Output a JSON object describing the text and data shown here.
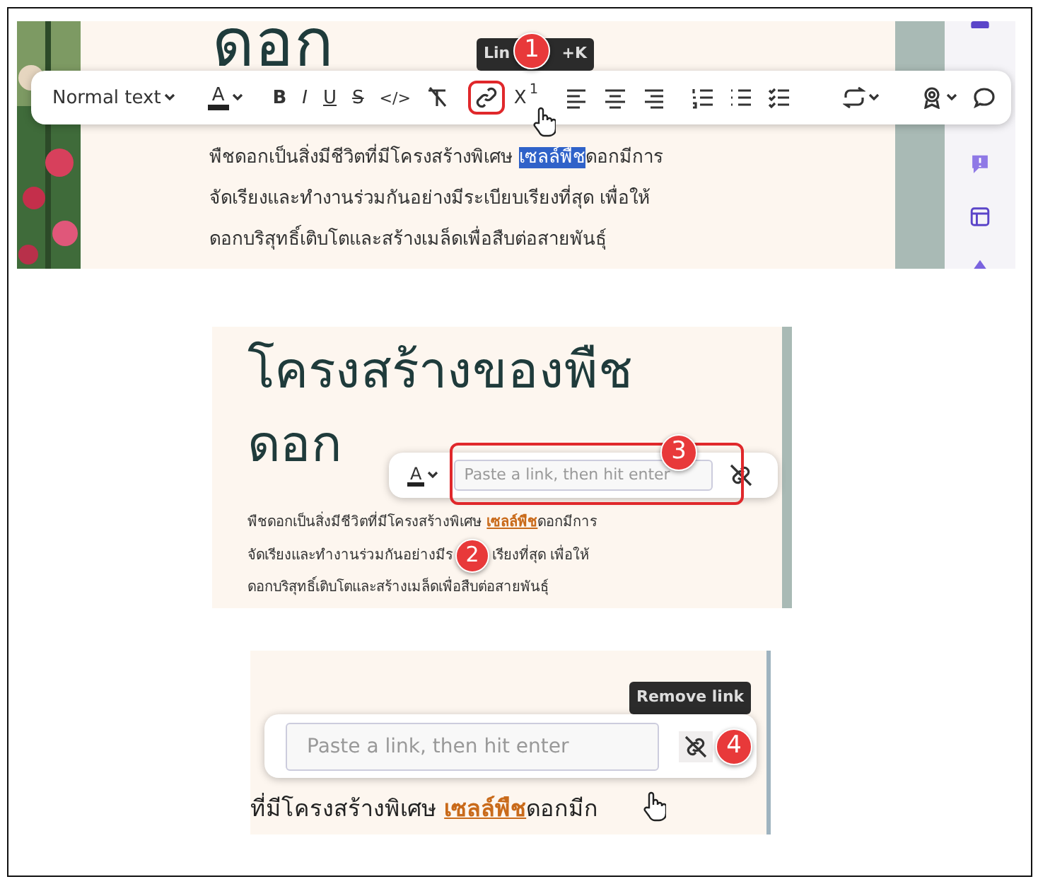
{
  "editor_view": {
    "title": "ดอก",
    "tooltip_parts": [
      "Lin",
      "+K"
    ],
    "callout": "1",
    "toolbar": [
      {
        "kind": "style-menu",
        "label": "Normal text",
        "dropdown": true,
        "highlighted": false
      },
      {
        "kind": "text-color",
        "label": "A",
        "dropdown": true,
        "highlighted": false
      },
      {
        "kind": "bold",
        "label": "B",
        "dropdown": false,
        "highlighted": false
      },
      {
        "kind": "italic",
        "label": "I",
        "dropdown": false,
        "highlighted": false
      },
      {
        "kind": "underline",
        "label": "U",
        "dropdown": false,
        "highlighted": false
      },
      {
        "kind": "strike",
        "label": "S",
        "dropdown": false,
        "highlighted": false
      },
      {
        "kind": "code",
        "label": "</>",
        "dropdown": false,
        "highlighted": false
      },
      {
        "kind": "clear-format",
        "dropdown": false,
        "highlighted": false
      },
      {
        "kind": "link",
        "dropdown": false,
        "highlighted": true
      },
      {
        "kind": "superscript",
        "label": "X$^{1}$",
        "dropdown": false,
        "highlighted": false
      },
      {
        "kind": "align-left",
        "dropdown": false,
        "highlighted": false
      },
      {
        "kind": "align-center",
        "dropdown": false,
        "highlighted": false
      },
      {
        "kind": "align-right",
        "dropdown": false,
        "highlighted": false
      },
      {
        "kind": "numbered-list",
        "dropdown": false,
        "highlighted": false
      },
      {
        "kind": "bullet-list",
        "dropdown": false,
        "highlighted": false
      },
      {
        "kind": "task-list",
        "dropdown": false,
        "highlighted": false
      },
      {
        "kind": "loop",
        "dropdown": true,
        "highlighted": false
      },
      {
        "kind": "ai",
        "dropdown": true,
        "highlighted": false
      },
      {
        "kind": "comment",
        "dropdown": false,
        "highlighted": false
      }
    ],
    "paragraph": {
      "line_1_before": "พืชดอกเป็นสิ่งมีชีวิตที่มีโครงสร้างพิเศษ ",
      "selected_word": "เซลล์พืช",
      "line_1_after": "ดอกมีการ",
      "lines": [
        "จัดเรียงและทำงานร่วมกันอย่างมีระเบียบเรียงที่สุด เพื่อให้",
        "ดอกบริสุทธิ์เติบโตและสร้างเมล็ดเพื่อสืบต่อสายพันธุ์"
      ]
    }
  },
  "link_editor_view": {
    "title_lines": [
      "โครงสร้างของพืช",
      "ดอก"
    ],
    "text_color_label": "A",
    "link_field": {
      "placeholder": "Paste a link, then hit enter"
    },
    "callouts": [
      "2",
      "3"
    ],
    "paragraph": {
      "line_1_before": "พืชดอกเป็นสิ่งมีชีวิตที่มีโครงสร้างพิเศษ ",
      "link_word": "เซลล์พืช",
      "line_1_after": "ดอกมีการ",
      "line_2_parts": [
        "จัดเรียงและทำงานร่วมกันอย่างมีร",
        "เรียงที่สุด เพื่อให้"
      ],
      "line_3": "ดอกบริสุทธิ์เติบโตและสร้างเมล็ดเพื่อสืบต่อสายพันธุ์"
    }
  },
  "remove_link_view": {
    "tooltip": "Remove link",
    "link_field": {
      "placeholder": "Paste a link, then hit enter"
    },
    "callout": "4",
    "line": {
      "before": "ที่มีโครงสร้างพิเศษ ",
      "link_word": "เซลล์พืช",
      "after": "ดอกมีก"
    }
  }
}
